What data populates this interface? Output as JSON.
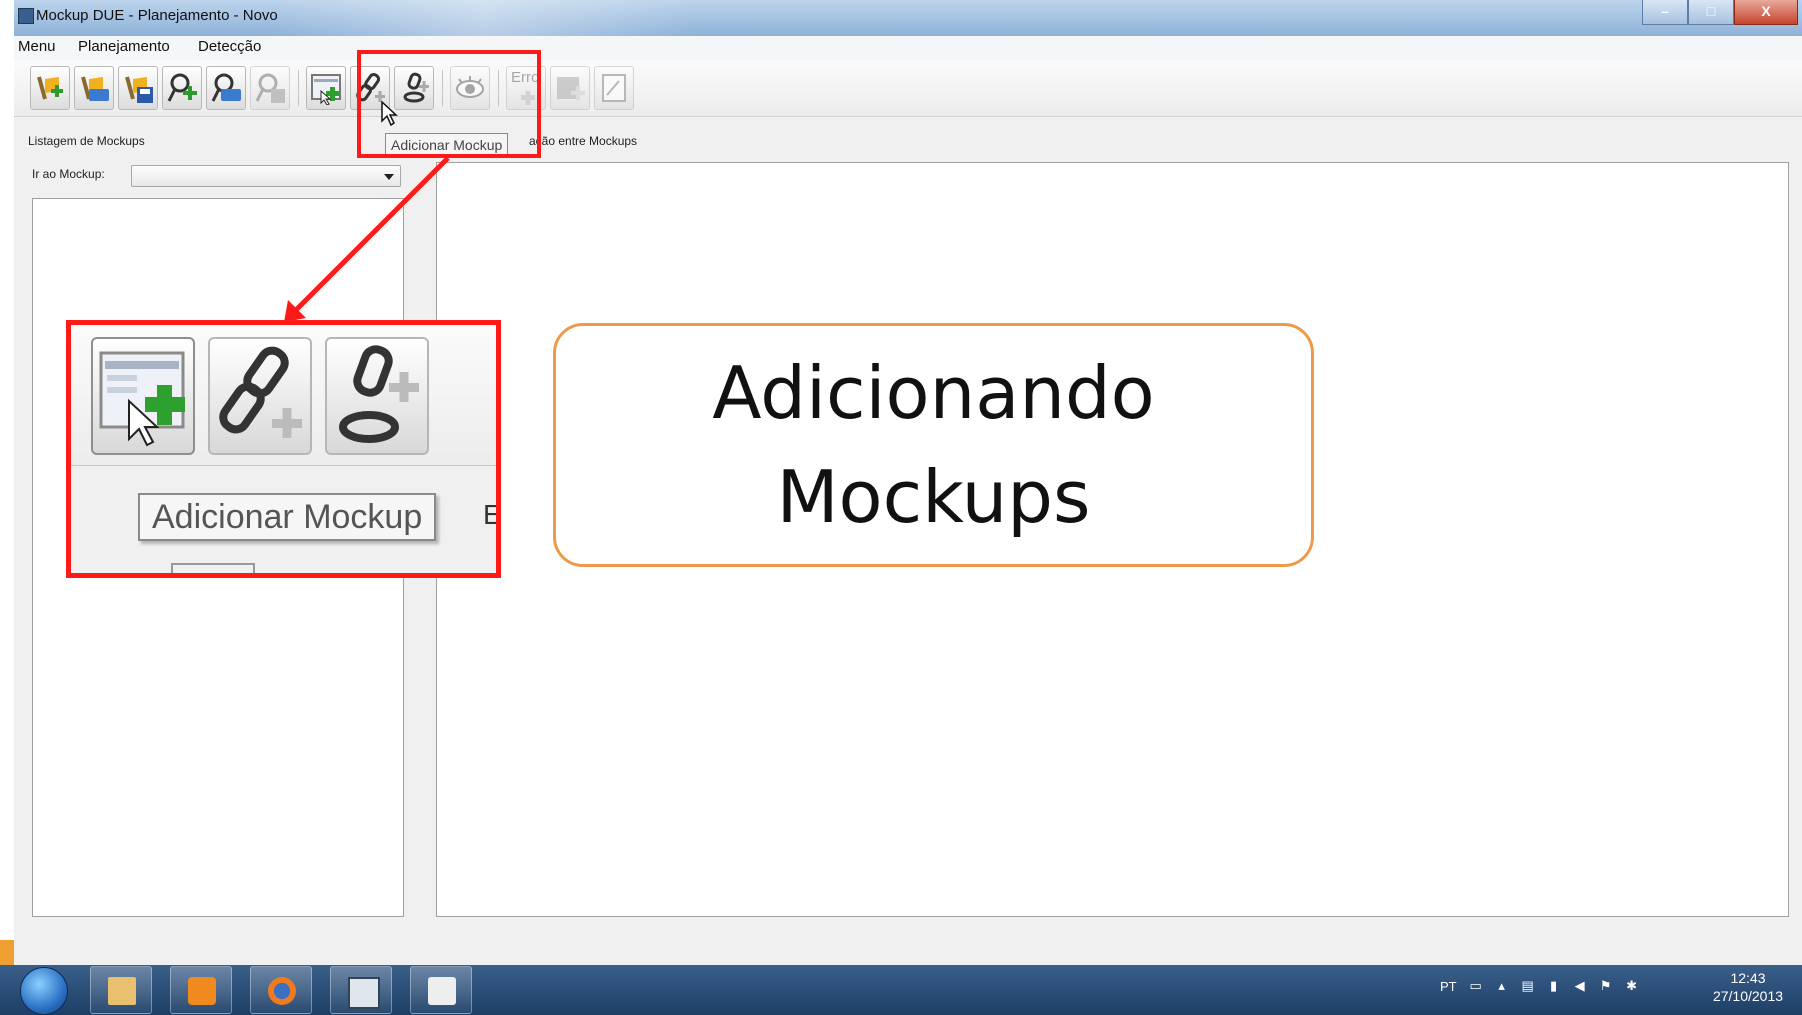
{
  "window": {
    "title": "Mockup DUE - Planejamento - Novo"
  },
  "menu": {
    "items": [
      "Menu",
      "Planejamento",
      "Detecção"
    ]
  },
  "toolbar": {
    "erro_label": "Erro",
    "tooltip": "Adicionar Mockup"
  },
  "left_panel": {
    "title": "Listagem de Mockups",
    "goto_label": "Ir ao Mockup:",
    "goto_value": ""
  },
  "right_panel": {
    "title_fragment": "ação entre Mockups"
  },
  "zoom": {
    "tooltip": "Adicionar Mockup",
    "edge_char": "E"
  },
  "callout": {
    "text": "Adicionando\nMockups"
  },
  "taskbar": {
    "language": "PT",
    "time": "12:43",
    "date": "27/10/2013"
  },
  "colors": {
    "highlight": "#ff1a1a",
    "callout_border": "#ee9a4a",
    "taskbar": "#1d3f66",
    "titlebar": "#8fb2d8"
  }
}
